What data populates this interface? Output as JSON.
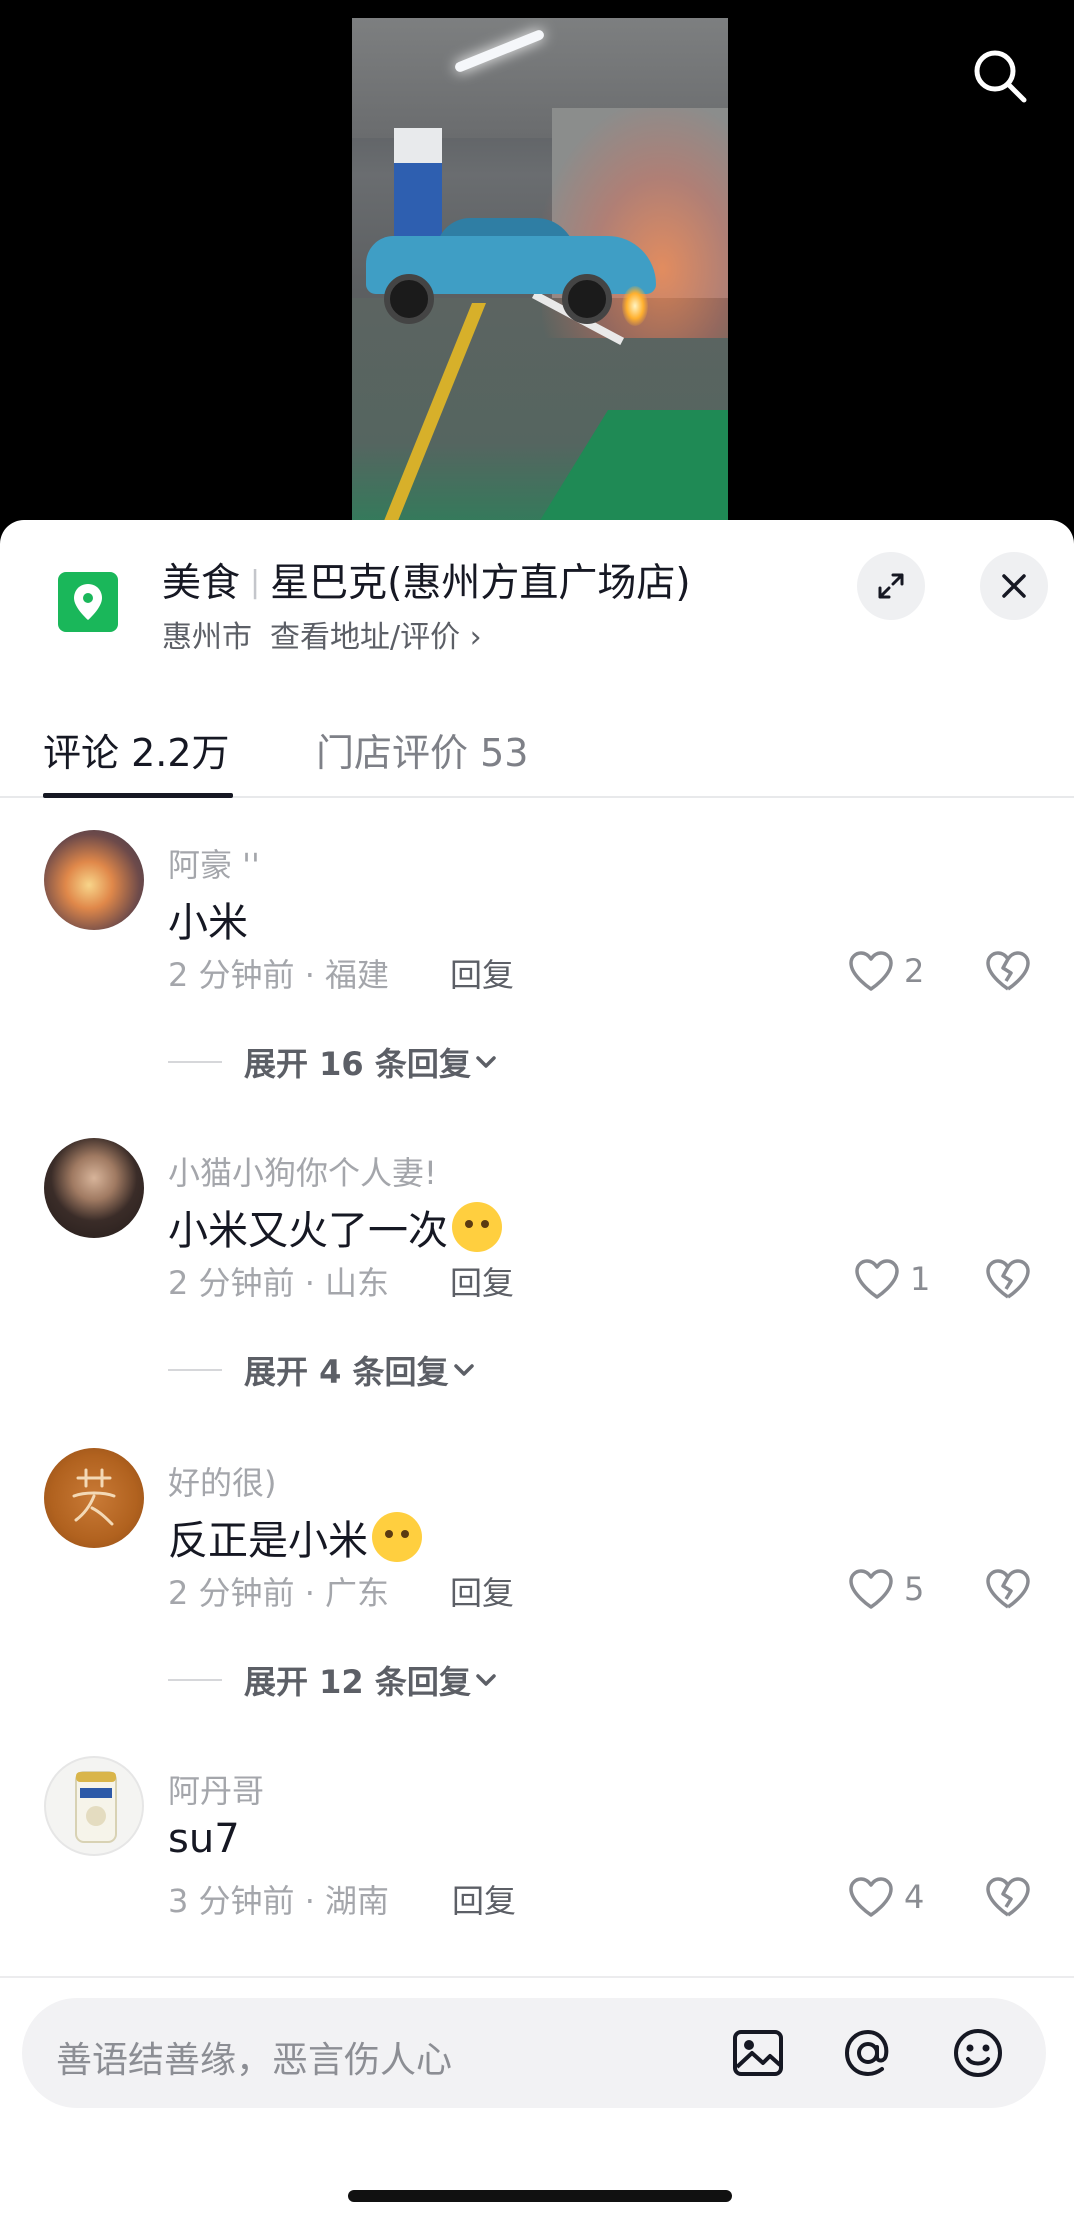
{
  "search": {
    "icon": "search-icon"
  },
  "poi": {
    "category": "美食",
    "name": "星巴克(惠州方直广场店)",
    "city": "惠州市",
    "link_label": "查看地址/评价 ›",
    "icon_color": "#1ab75a"
  },
  "tabs": [
    {
      "label": "评论 2.2万",
      "active": true
    },
    {
      "label": "门店评价 53",
      "active": false
    }
  ],
  "comments": [
    {
      "user": "阿豪 ''",
      "text": "小米",
      "meta": "2 分钟前 · 福建",
      "reply": "回复",
      "likes": "2",
      "expand": "展开 16 条回复"
    },
    {
      "user": "小猫小狗你个人妻!",
      "text": "小米又火了一次",
      "meta": "2 分钟前 · 山东",
      "reply": "回复",
      "likes": "1",
      "expand": "展开 4 条回复"
    },
    {
      "user": "好的很)",
      "text": "反正是小米",
      "meta": "2 分钟前 · 广东",
      "reply": "回复",
      "likes": "5",
      "expand": "展开 12 条回复"
    },
    {
      "user": "阿丹哥",
      "text": "su7",
      "meta": "3 分钟前 · 湖南",
      "reply": "回复",
      "likes": "4",
      "expand": ""
    }
  ],
  "input": {
    "placeholder": "善语结善缘，恶言伤人心"
  },
  "colors": {
    "accent_green": "#1ab75a",
    "text_primary": "#161823",
    "text_secondary": "#a4a6ab"
  }
}
